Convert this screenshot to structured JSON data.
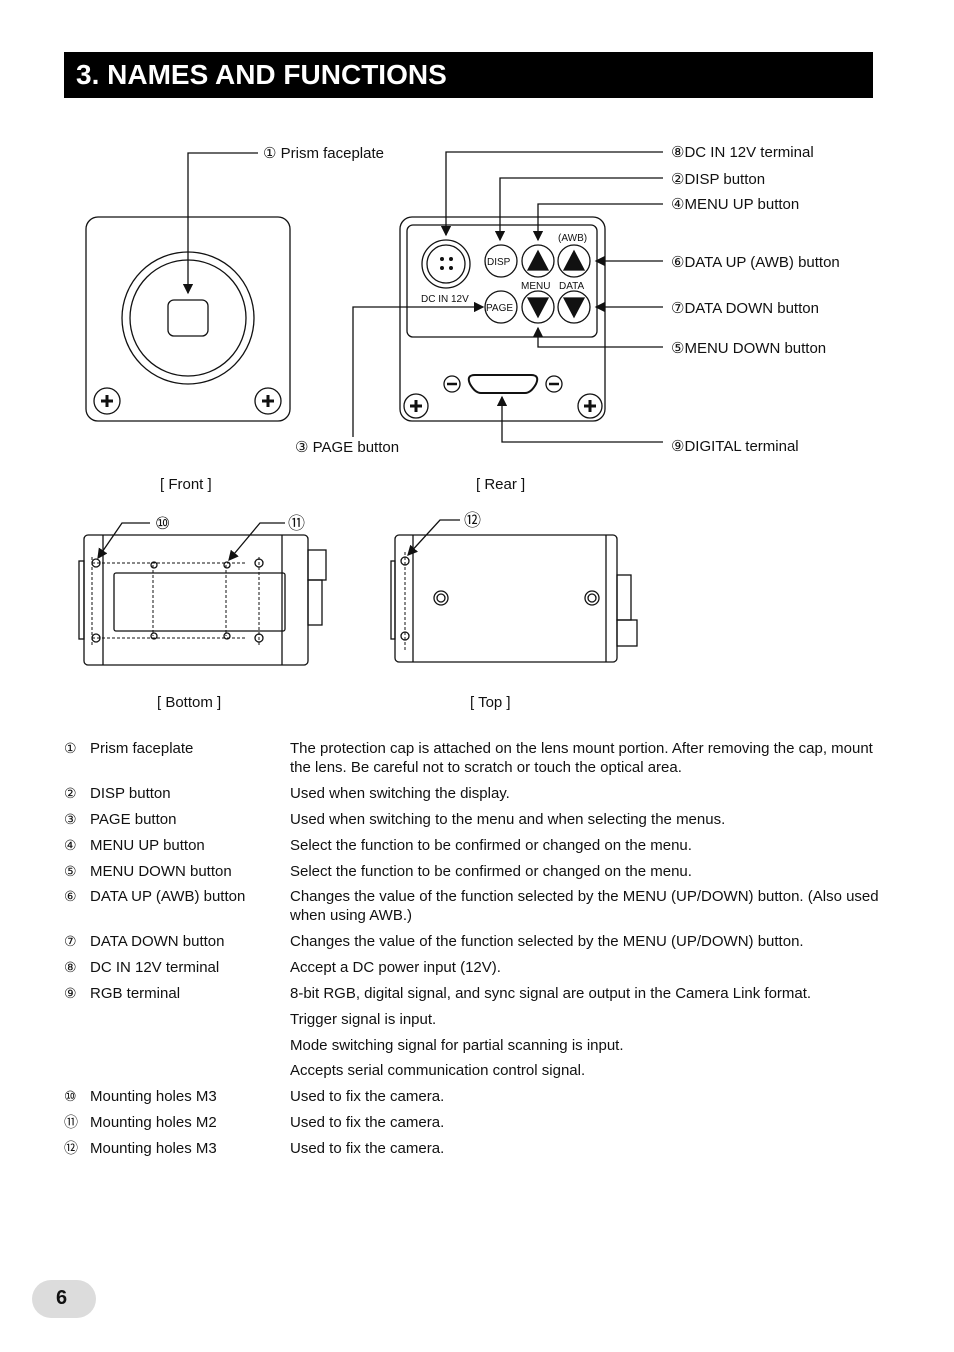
{
  "header": {
    "title": "3. NAMES AND FUNCTIONS"
  },
  "diagram": {
    "callouts": {
      "c1": "① Prism faceplate",
      "c8": "⑧DC IN 12V terminal",
      "c2": "②DISP button",
      "c4": "④MENU UP button",
      "c6": "⑥DATA UP (AWB) button",
      "c7": "⑦DATA DOWN button",
      "c5": "⑤MENU DOWN button",
      "c3": "③ PAGE button",
      "c9": "⑨DIGITAL terminal",
      "c10": "⑩",
      "c11": "⑪",
      "c12": "⑫"
    },
    "panel": {
      "disp": "DISP",
      "page": "PAGE",
      "awb": "(AWB)",
      "menu": "MENU",
      "data": "DATA",
      "dcin": "DC IN 12V"
    },
    "views": {
      "front": "[ Front ]",
      "rear": "[ Rear ]",
      "bottom": "[ Bottom ]",
      "top": "[ Top ]"
    }
  },
  "table": [
    {
      "num": "①",
      "name": "Prism faceplate",
      "desc": "The protection cap is attached on the lens mount portion. After removing the cap, mount the lens. Be careful not to scratch or touch the optical area."
    },
    {
      "num": "②",
      "name": "DISP button",
      "desc": "Used when switching the display."
    },
    {
      "num": "③",
      "name": "PAGE button",
      "desc": "Used when switching to the menu and when selecting the menus."
    },
    {
      "num": "④",
      "name": "MENU UP button",
      "desc": "Select the function to be confirmed or changed on the menu."
    },
    {
      "num": "⑤",
      "name": "MENU DOWN button",
      "desc": "Select the function to be confirmed or changed on the menu."
    },
    {
      "num": "⑥",
      "name": "DATA UP (AWB) button",
      "desc": "Changes the value of the function selected by the MENU (UP/DOWN) button. (Also used when using AWB.)"
    },
    {
      "num": "⑦",
      "name": "DATA DOWN button",
      "desc": "Changes the value of the function selected by the MENU (UP/DOWN) button."
    },
    {
      "num": "⑧",
      "name": "DC IN 12V terminal",
      "desc": "Accept a DC power input (12V)."
    },
    {
      "num": "⑨",
      "name": "RGB terminal",
      "desc": "8-bit RGB, digital signal, and sync signal are output in the Camera Link format."
    },
    {
      "num": "",
      "name": "",
      "desc": "Trigger signal is input."
    },
    {
      "num": "",
      "name": "",
      "desc": "Mode switching signal for partial scanning is input."
    },
    {
      "num": "",
      "name": "",
      "desc": "Accepts serial communication control signal."
    },
    {
      "num": "⑩",
      "name": "Mounting holes M3",
      "desc": "Used to fix the camera."
    },
    {
      "num": "⑪",
      "name": "Mounting holes M2",
      "desc": "Used to fix the camera."
    },
    {
      "num": "⑫",
      "name": "Mounting holes M3",
      "desc": "Used to fix the camera."
    }
  ],
  "footer": {
    "page_number": "6"
  }
}
